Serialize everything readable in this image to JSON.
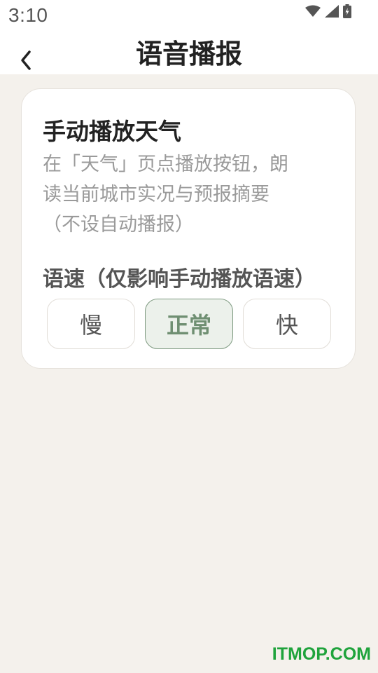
{
  "status_bar": {
    "time": "3:10",
    "icons": [
      "wifi-icon",
      "signal-icon",
      "battery-charging-icon"
    ]
  },
  "header": {
    "title": "语音播报",
    "back_icon": "chevron-left-icon"
  },
  "card": {
    "title": "手动播放天气",
    "desc_line1": "在「天气」页点播放按钮，朗",
    "desc_line2": "读当前城市实况与预报摘要",
    "desc_line3": "（不设自动播报）",
    "speed_label": "语速（仅影响手动播放语速）",
    "speed_options": [
      {
        "label": "慢",
        "selected": false
      },
      {
        "label": "正常",
        "selected": true
      },
      {
        "label": "快",
        "selected": false
      }
    ]
  },
  "watermark": "ITMOP.COM",
  "colors": {
    "background": "#f4f1ec",
    "card": "#ffffff",
    "accent": "#7e9a80",
    "watermark": "#1fa33c"
  }
}
